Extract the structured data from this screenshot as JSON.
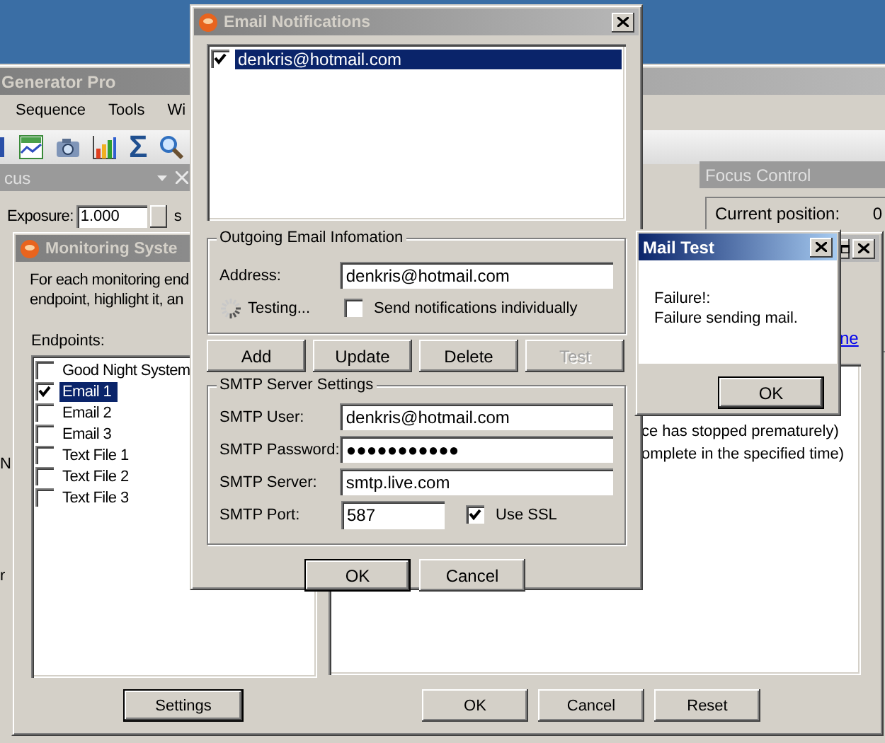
{
  "main_window": {
    "title": "Generator Pro",
    "active": false,
    "menu": [
      "Sequence",
      "Tools",
      "Wi"
    ],
    "toolbar": [
      {
        "kind": "window"
      },
      {
        "kind": "chart"
      },
      {
        "kind": "camera"
      },
      {
        "kind": "bars"
      },
      {
        "kind": "glyph",
        "text": "Σ"
      },
      {
        "kind": "magnifier"
      }
    ],
    "focus_panel": {
      "title": "cus",
      "exposure": {
        "label": "Exposure:",
        "value": "1.000",
        "unit": "s"
      }
    },
    "left_fragments": [
      "N",
      "r"
    ],
    "focus_control": {
      "title": "Focus Control",
      "rows": [
        {
          "label": "Current position:",
          "value": "0"
        }
      ]
    }
  },
  "monitoring_window": {
    "title": "Monitoring Syste",
    "active": false,
    "intro": [
      "For each monitoring end",
      "endpoint, highlight it, an"
    ],
    "endpoints_label": "Endpoints:",
    "endpoints": [
      {
        "label": "Good Night System",
        "checked": false,
        "selected": false
      },
      {
        "label": "Email 1",
        "checked": true,
        "selected": true
      },
      {
        "label": "Email 2",
        "checked": false,
        "selected": false
      },
      {
        "label": "Email 3",
        "checked": false,
        "selected": false
      },
      {
        "label": "Text File 1",
        "checked": false,
        "selected": false
      },
      {
        "label": "Text File 2",
        "checked": false,
        "selected": false
      },
      {
        "label": "Text File 3",
        "checked": false,
        "selected": false
      }
    ],
    "link": "ne",
    "notes": [
      "ce has stopped prematurely)",
      "omplete in the specified time)"
    ],
    "settings_button": "Settings",
    "buttons": [
      "OK",
      "Cancel",
      "Reset"
    ]
  },
  "email_window": {
    "title": "Email Notifications",
    "active": false,
    "recipients": [
      {
        "label": "denkris@hotmail.com",
        "checked": true,
        "selected": true
      }
    ],
    "outgoing": {
      "title": "Outgoing Email Infomation",
      "address_label": "Address:",
      "address": "denkris@hotmail.com",
      "status": "Testing...",
      "individually": {
        "label": "Send notifications individually",
        "checked": false
      }
    },
    "actions": [
      {
        "label": "Add",
        "disabled": false
      },
      {
        "label": "Update",
        "disabled": false
      },
      {
        "label": "Delete",
        "disabled": false
      },
      {
        "label": "Test",
        "disabled": true
      }
    ],
    "smtp": {
      "title": "SMTP Server Settings",
      "fields": [
        {
          "label": "SMTP User:",
          "value": "denkris@hotmail.com"
        },
        {
          "label": "SMTP Password:",
          "value": "●●●●●●●●●●●"
        },
        {
          "label": "SMTP Server:",
          "value": "smtp.live.com"
        }
      ],
      "port_label": "SMTP Port:",
      "port": "587",
      "ssl": {
        "label": "Use SSL",
        "checked": true
      }
    },
    "buttons": [
      "OK",
      "Cancel"
    ]
  },
  "mail_test": {
    "title": "Mail Test",
    "active": true,
    "message": [
      "Failure!:",
      "Failure sending mail."
    ],
    "button": "OK"
  }
}
